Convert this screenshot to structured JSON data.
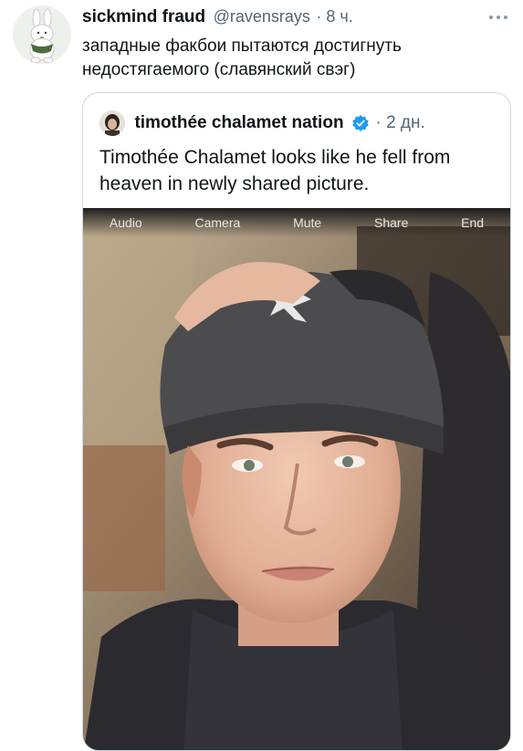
{
  "tweet": {
    "author_name": "sickmind fraud",
    "handle": "@ravensrays",
    "time": "· 8 ч.",
    "text": "западные факбои пытаются достигнуть недостягаемого (славянский свэг)",
    "avatar_icon": "bunny-avatar-icon",
    "more_icon": "more-dots-icon"
  },
  "quoted": {
    "author_name": "timothée chalamet nation",
    "time": "· 2 дн.",
    "verified_icon": "verified-badge-icon",
    "verified_color": "#1d9bf0",
    "text": "Timothée Chalamet looks like he fell from heaven in newly shared picture."
  },
  "call_bar": {
    "buttons": [
      "Audio",
      "Camera",
      "Mute",
      "Share",
      "End"
    ]
  },
  "colors": {
    "text": "#0f1419",
    "secondary": "#536471",
    "border": "#cfd9de"
  }
}
